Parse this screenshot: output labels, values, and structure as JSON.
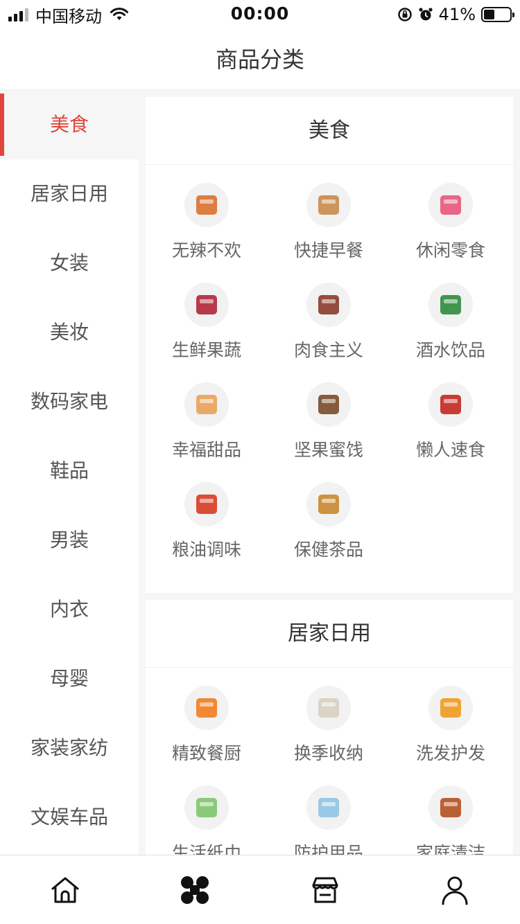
{
  "status_bar": {
    "carrier": "中国移动",
    "time": "00:00",
    "battery_percent": "41%",
    "battery_level": 0.41
  },
  "nav": {
    "title": "商品分类"
  },
  "sidebar": {
    "items": [
      {
        "label": "美食",
        "active": true
      },
      {
        "label": "居家日用"
      },
      {
        "label": "女装"
      },
      {
        "label": "美妆"
      },
      {
        "label": "数码家电"
      },
      {
        "label": "鞋品"
      },
      {
        "label": "男装"
      },
      {
        "label": "内衣"
      },
      {
        "label": "母婴"
      },
      {
        "label": "家装家纺"
      },
      {
        "label": "文娱车品"
      }
    ]
  },
  "sections": [
    {
      "title": "美食",
      "items": [
        {
          "label": "无辣不欢",
          "icon": "spicy-meat-icon",
          "color": "#d9702e"
        },
        {
          "label": "快捷早餐",
          "icon": "bread-milk-icon",
          "color": "#c98a4b"
        },
        {
          "label": "休闲零食",
          "icon": "chips-bag-icon",
          "color": "#e8567a"
        },
        {
          "label": "生鲜果蔬",
          "icon": "fruits-icon",
          "color": "#b0263a"
        },
        {
          "label": "肉食主义",
          "icon": "meat-box-icon",
          "color": "#8a3b2a"
        },
        {
          "label": "酒水饮品",
          "icon": "bottles-icon",
          "color": "#2e8b3c"
        },
        {
          "label": "幸福甜品",
          "icon": "macarons-icon",
          "color": "#e9a15a"
        },
        {
          "label": "坚果蜜饯",
          "icon": "nuts-box-icon",
          "color": "#7a4a2a"
        },
        {
          "label": "懒人速食",
          "icon": "instant-noodles-icon",
          "color": "#c4271f"
        },
        {
          "label": "粮油调味",
          "icon": "oil-rice-icon",
          "color": "#d63b22"
        },
        {
          "label": "保健茶品",
          "icon": "tea-box-icon",
          "color": "#c9872f"
        }
      ]
    },
    {
      "title": "居家日用",
      "items": [
        {
          "label": "精致餐厨",
          "icon": "casserole-pot-icon",
          "color": "#ef7d1c"
        },
        {
          "label": "换季收纳",
          "icon": "storage-drawer-icon",
          "color": "#d8cfc0"
        },
        {
          "label": "洗发护发",
          "icon": "shampoo-bottle-icon",
          "color": "#f09a1e"
        },
        {
          "label": "生活纸巾",
          "icon": "tissue-pack-icon",
          "color": "#7ec46a"
        },
        {
          "label": "防护用品",
          "icon": "face-mask-icon",
          "color": "#8fc4e6"
        },
        {
          "label": "家庭清洁",
          "icon": "disinfectant-bottle-icon",
          "color": "#b5501f"
        }
      ]
    }
  ],
  "tab_bar": {
    "tabs": [
      {
        "icon": "home-icon",
        "active": false
      },
      {
        "icon": "category-icon",
        "active": true
      },
      {
        "icon": "store-icon",
        "active": false
      },
      {
        "icon": "profile-icon",
        "active": false
      }
    ]
  }
}
